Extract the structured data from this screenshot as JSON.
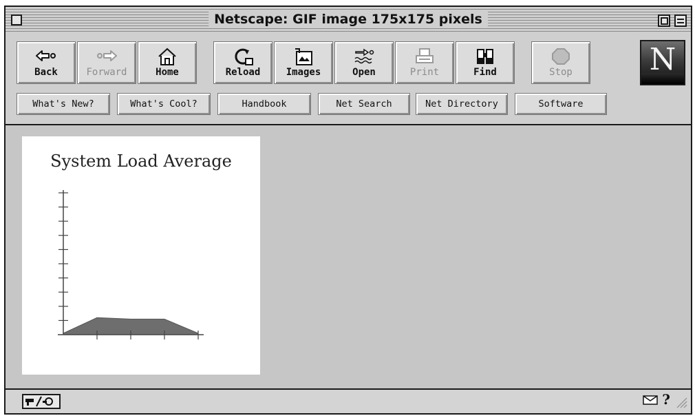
{
  "window": {
    "title": "Netscape: GIF image 175x175 pixels"
  },
  "toolbar": {
    "buttons": [
      {
        "label": "Back",
        "icon": "back-arrow-icon",
        "enabled": true
      },
      {
        "label": "Forward",
        "icon": "forward-arrow-icon",
        "enabled": false
      },
      {
        "label": "Home",
        "icon": "home-icon",
        "enabled": true
      },
      {
        "label": "Reload",
        "icon": "reload-icon",
        "enabled": true
      },
      {
        "label": "Images",
        "icon": "images-icon",
        "enabled": true
      },
      {
        "label": "Open",
        "icon": "open-icon",
        "enabled": true
      },
      {
        "label": "Print",
        "icon": "printer-icon",
        "enabled": false
      },
      {
        "label": "Find",
        "icon": "binoculars-icon",
        "enabled": true
      },
      {
        "label": "Stop",
        "icon": "stop-icon",
        "enabled": false
      }
    ],
    "logo_letter": "N"
  },
  "directory": {
    "buttons": [
      "What's New?",
      "What's Cool?",
      "Handbook",
      "Net Search",
      "Net Directory",
      "Software"
    ]
  },
  "content": {
    "image_title": "System Load Average"
  },
  "chart_data": {
    "type": "area",
    "title": "System Load Average",
    "xlabel": "",
    "ylabel": "",
    "x": [
      0,
      1,
      2,
      3,
      4
    ],
    "values": [
      0.1,
      1.2,
      1.1,
      1.1,
      0.1
    ],
    "ylim": [
      0,
      10
    ],
    "xlim": [
      0,
      4
    ],
    "y_ticks": 10,
    "x_ticks": 4,
    "fill_color": "#6e6e6e",
    "grid": false
  },
  "statusbar": {
    "help_glyph": "?"
  },
  "colors": {
    "chrome": "#cfcfcf",
    "content_bg": "#c6c6c6",
    "image_bg": "#ffffff"
  }
}
